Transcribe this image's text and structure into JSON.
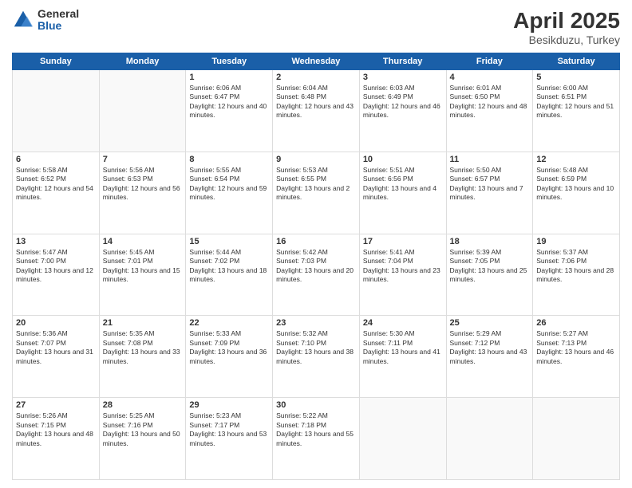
{
  "logo": {
    "general": "General",
    "blue": "Blue"
  },
  "title": "April 2025",
  "location": "Besikduzu, Turkey",
  "days_header": [
    "Sunday",
    "Monday",
    "Tuesday",
    "Wednesday",
    "Thursday",
    "Friday",
    "Saturday"
  ],
  "weeks": [
    [
      {
        "day": "",
        "sunrise": "",
        "sunset": "",
        "daylight": ""
      },
      {
        "day": "",
        "sunrise": "",
        "sunset": "",
        "daylight": ""
      },
      {
        "day": "1",
        "sunrise": "Sunrise: 6:06 AM",
        "sunset": "Sunset: 6:47 PM",
        "daylight": "Daylight: 12 hours and 40 minutes."
      },
      {
        "day": "2",
        "sunrise": "Sunrise: 6:04 AM",
        "sunset": "Sunset: 6:48 PM",
        "daylight": "Daylight: 12 hours and 43 minutes."
      },
      {
        "day": "3",
        "sunrise": "Sunrise: 6:03 AM",
        "sunset": "Sunset: 6:49 PM",
        "daylight": "Daylight: 12 hours and 46 minutes."
      },
      {
        "day": "4",
        "sunrise": "Sunrise: 6:01 AM",
        "sunset": "Sunset: 6:50 PM",
        "daylight": "Daylight: 12 hours and 48 minutes."
      },
      {
        "day": "5",
        "sunrise": "Sunrise: 6:00 AM",
        "sunset": "Sunset: 6:51 PM",
        "daylight": "Daylight: 12 hours and 51 minutes."
      }
    ],
    [
      {
        "day": "6",
        "sunrise": "Sunrise: 5:58 AM",
        "sunset": "Sunset: 6:52 PM",
        "daylight": "Daylight: 12 hours and 54 minutes."
      },
      {
        "day": "7",
        "sunrise": "Sunrise: 5:56 AM",
        "sunset": "Sunset: 6:53 PM",
        "daylight": "Daylight: 12 hours and 56 minutes."
      },
      {
        "day": "8",
        "sunrise": "Sunrise: 5:55 AM",
        "sunset": "Sunset: 6:54 PM",
        "daylight": "Daylight: 12 hours and 59 minutes."
      },
      {
        "day": "9",
        "sunrise": "Sunrise: 5:53 AM",
        "sunset": "Sunset: 6:55 PM",
        "daylight": "Daylight: 13 hours and 2 minutes."
      },
      {
        "day": "10",
        "sunrise": "Sunrise: 5:51 AM",
        "sunset": "Sunset: 6:56 PM",
        "daylight": "Daylight: 13 hours and 4 minutes."
      },
      {
        "day": "11",
        "sunrise": "Sunrise: 5:50 AM",
        "sunset": "Sunset: 6:57 PM",
        "daylight": "Daylight: 13 hours and 7 minutes."
      },
      {
        "day": "12",
        "sunrise": "Sunrise: 5:48 AM",
        "sunset": "Sunset: 6:59 PM",
        "daylight": "Daylight: 13 hours and 10 minutes."
      }
    ],
    [
      {
        "day": "13",
        "sunrise": "Sunrise: 5:47 AM",
        "sunset": "Sunset: 7:00 PM",
        "daylight": "Daylight: 13 hours and 12 minutes."
      },
      {
        "day": "14",
        "sunrise": "Sunrise: 5:45 AM",
        "sunset": "Sunset: 7:01 PM",
        "daylight": "Daylight: 13 hours and 15 minutes."
      },
      {
        "day": "15",
        "sunrise": "Sunrise: 5:44 AM",
        "sunset": "Sunset: 7:02 PM",
        "daylight": "Daylight: 13 hours and 18 minutes."
      },
      {
        "day": "16",
        "sunrise": "Sunrise: 5:42 AM",
        "sunset": "Sunset: 7:03 PM",
        "daylight": "Daylight: 13 hours and 20 minutes."
      },
      {
        "day": "17",
        "sunrise": "Sunrise: 5:41 AM",
        "sunset": "Sunset: 7:04 PM",
        "daylight": "Daylight: 13 hours and 23 minutes."
      },
      {
        "day": "18",
        "sunrise": "Sunrise: 5:39 AM",
        "sunset": "Sunset: 7:05 PM",
        "daylight": "Daylight: 13 hours and 25 minutes."
      },
      {
        "day": "19",
        "sunrise": "Sunrise: 5:37 AM",
        "sunset": "Sunset: 7:06 PM",
        "daylight": "Daylight: 13 hours and 28 minutes."
      }
    ],
    [
      {
        "day": "20",
        "sunrise": "Sunrise: 5:36 AM",
        "sunset": "Sunset: 7:07 PM",
        "daylight": "Daylight: 13 hours and 31 minutes."
      },
      {
        "day": "21",
        "sunrise": "Sunrise: 5:35 AM",
        "sunset": "Sunset: 7:08 PM",
        "daylight": "Daylight: 13 hours and 33 minutes."
      },
      {
        "day": "22",
        "sunrise": "Sunrise: 5:33 AM",
        "sunset": "Sunset: 7:09 PM",
        "daylight": "Daylight: 13 hours and 36 minutes."
      },
      {
        "day": "23",
        "sunrise": "Sunrise: 5:32 AM",
        "sunset": "Sunset: 7:10 PM",
        "daylight": "Daylight: 13 hours and 38 minutes."
      },
      {
        "day": "24",
        "sunrise": "Sunrise: 5:30 AM",
        "sunset": "Sunset: 7:11 PM",
        "daylight": "Daylight: 13 hours and 41 minutes."
      },
      {
        "day": "25",
        "sunrise": "Sunrise: 5:29 AM",
        "sunset": "Sunset: 7:12 PM",
        "daylight": "Daylight: 13 hours and 43 minutes."
      },
      {
        "day": "26",
        "sunrise": "Sunrise: 5:27 AM",
        "sunset": "Sunset: 7:13 PM",
        "daylight": "Daylight: 13 hours and 46 minutes."
      }
    ],
    [
      {
        "day": "27",
        "sunrise": "Sunrise: 5:26 AM",
        "sunset": "Sunset: 7:15 PM",
        "daylight": "Daylight: 13 hours and 48 minutes."
      },
      {
        "day": "28",
        "sunrise": "Sunrise: 5:25 AM",
        "sunset": "Sunset: 7:16 PM",
        "daylight": "Daylight: 13 hours and 50 minutes."
      },
      {
        "day": "29",
        "sunrise": "Sunrise: 5:23 AM",
        "sunset": "Sunset: 7:17 PM",
        "daylight": "Daylight: 13 hours and 53 minutes."
      },
      {
        "day": "30",
        "sunrise": "Sunrise: 5:22 AM",
        "sunset": "Sunset: 7:18 PM",
        "daylight": "Daylight: 13 hours and 55 minutes."
      },
      {
        "day": "",
        "sunrise": "",
        "sunset": "",
        "daylight": ""
      },
      {
        "day": "",
        "sunrise": "",
        "sunset": "",
        "daylight": ""
      },
      {
        "day": "",
        "sunrise": "",
        "sunset": "",
        "daylight": ""
      }
    ]
  ]
}
